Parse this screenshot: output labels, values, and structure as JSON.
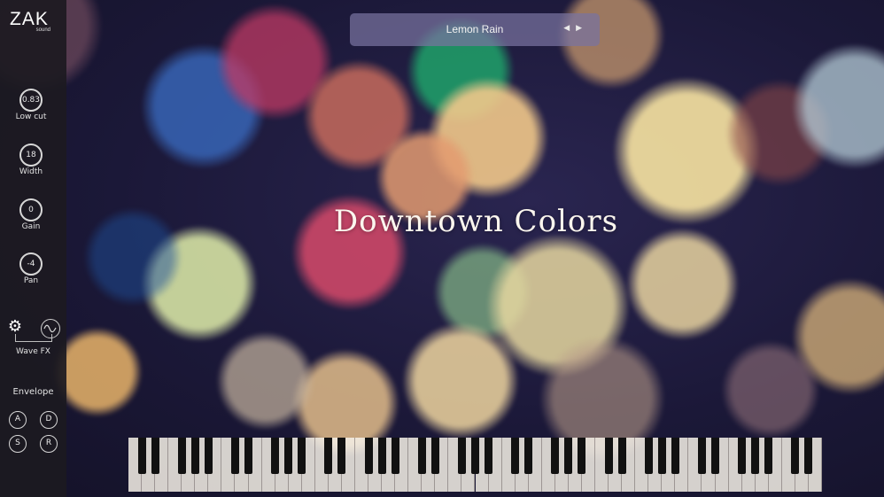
{
  "brand": {
    "name": "ZAK",
    "subtitle": "sound"
  },
  "preset": {
    "name": "Lemon Rain",
    "arrows": "◀ ▶"
  },
  "title": "Downtown Colors",
  "controls": [
    {
      "label": "Low cut",
      "value": "0.83"
    },
    {
      "label": "Width",
      "value": "18"
    },
    {
      "label": "Gain",
      "value": "0"
    },
    {
      "label": "Pan",
      "value": "-4"
    }
  ],
  "wavefx": {
    "label": "Wave FX"
  },
  "envelope": {
    "title": "Envelope",
    "knobs": [
      "A",
      "D",
      "S",
      "R"
    ]
  },
  "icons": {
    "settings": "gear-icon",
    "wave": "sine-wave-icon"
  },
  "keyboard": {
    "white_keys": 52
  }
}
